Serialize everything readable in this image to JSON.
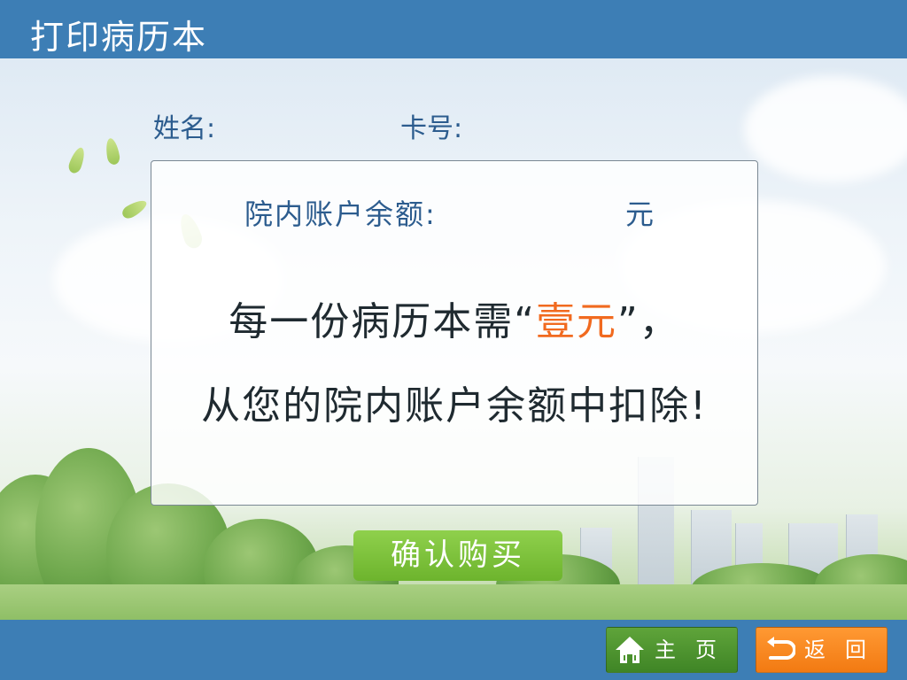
{
  "header": {
    "title": "打印病历本"
  },
  "patient": {
    "name_label": "姓名:",
    "card_label": "卡号:"
  },
  "panel": {
    "balance_label": "院内账户余额:",
    "balance_unit": "元",
    "message_line1_before": "每一份病历本需“",
    "message_price": "壹元",
    "message_line1_after": "”，",
    "message_line2": "从您的院内账户余额中扣除!"
  },
  "actions": {
    "confirm_label": "确认购买"
  },
  "footer": {
    "home_label": "主页",
    "back_label": "返回"
  },
  "icons": {
    "home": "home-icon",
    "back": "return-arrow-icon"
  },
  "colors": {
    "header_bg": "#3d7eb5",
    "price_text": "#f16a1f",
    "confirm_button": "#7bc23a",
    "home_button": "#4f9530",
    "back_button": "#f88a20"
  }
}
